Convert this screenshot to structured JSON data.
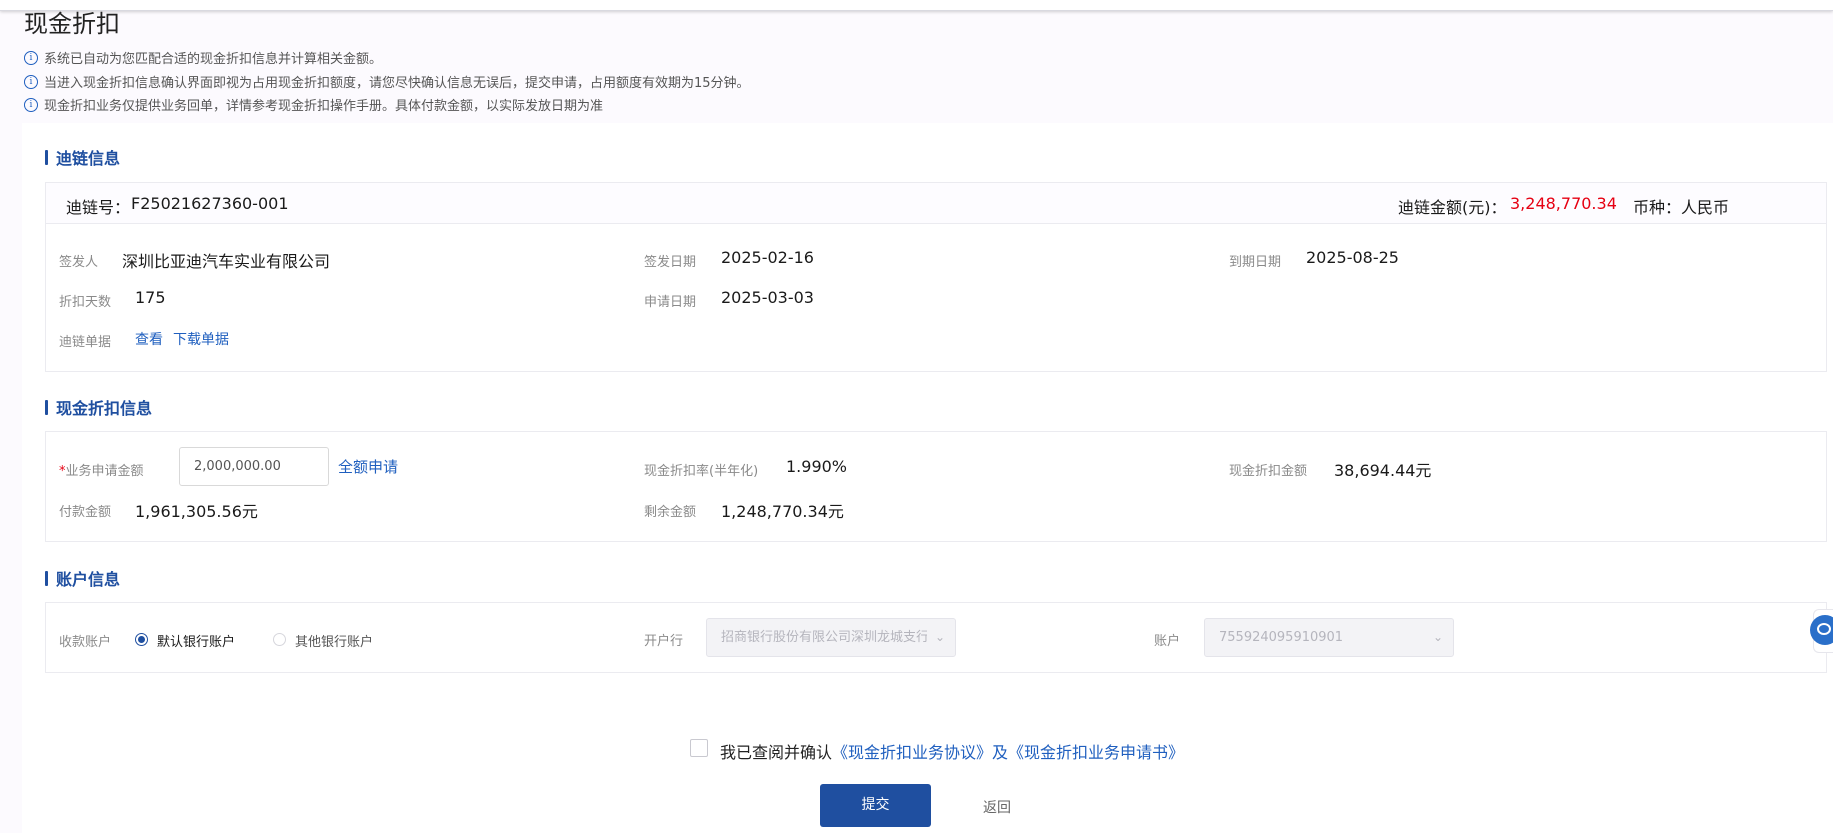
{
  "page": {
    "title": "现金折扣",
    "notices": [
      "系统已自动为您匹配合适的现金折扣信息并计算相关金额。",
      "当进入现金折扣信息确认界面即视为占用现金折扣额度，请您尽快确认信息无误后，提交申请，占用额度有效期为15分钟。",
      "现金折扣业务仅提供业务回单，详情参考现金折扣操作手册。具体付款金额，以实际发放日期为准"
    ]
  },
  "chain_info": {
    "section_title": "迪链信息",
    "chain_no_label": "迪链号：",
    "chain_no": "F25021627360-001",
    "amount_label": "迪链金额(元)：",
    "amount": "3,248,770.34",
    "currency_label": "币种：",
    "currency": "人民币",
    "issuer_label": "签发人",
    "issuer": "深圳比亚迪汽车实业有限公司",
    "issue_date_label": "签发日期",
    "issue_date": "2025-02-16",
    "due_date_label": "到期日期",
    "due_date": "2025-08-25",
    "discount_days_label": "折扣天数",
    "discount_days": "175",
    "apply_date_label": "申请日期",
    "apply_date": "2025-03-03",
    "document_label": "迪链单据",
    "view_link": "查看",
    "download_link": "下载单据"
  },
  "discount_info": {
    "section_title": "现金折扣信息",
    "required_mark": "*",
    "apply_amount_label": "业务申请金额",
    "apply_amount_value": "2,000,000.00",
    "full_apply_link": "全额申请",
    "rate_label": "现金折扣率(半年化)",
    "rate": "1.990%",
    "discount_amount_label": "现金折扣金额",
    "discount_amount": "38,694.44元",
    "payment_amount_label": "付款金额",
    "payment_amount": "1,961,305.56元",
    "remaining_amount_label": "剩余金额",
    "remaining_amount": "1,248,770.34元"
  },
  "account_info": {
    "section_title": "账户信息",
    "receive_account_label": "收款账户",
    "radio_default": "默认银行账户",
    "radio_other": "其他银行账户",
    "selected": "默认银行账户",
    "bank_label": "开户行",
    "bank_value": "招商银行股份有限公司深圳龙城支行",
    "account_label": "账户",
    "account_value": "755924095910901"
  },
  "footer": {
    "agree_prefix": "我已查阅并确认",
    "agreement_link": "《现金折扣业务协议》",
    "and_text": "及",
    "application_link": "《现金折扣业务申请书》",
    "submit_label": "提交",
    "back_label": "返回"
  },
  "colors": {
    "accent": "#1f4fa0",
    "link": "#1f5fbf",
    "amount_red": "#e60012"
  },
  "icons": {
    "notice": "info-icon",
    "chevron": "chevron-down-icon",
    "support": "customer-service-icon"
  }
}
